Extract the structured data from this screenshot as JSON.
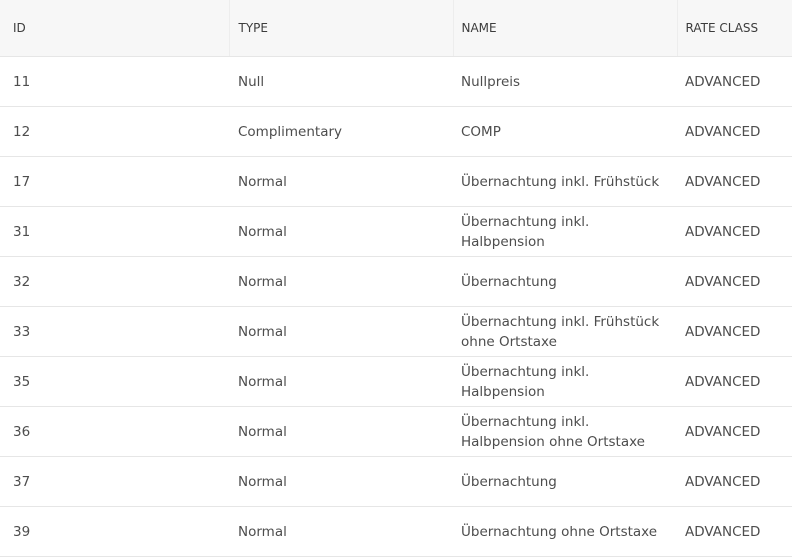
{
  "table": {
    "headers": {
      "id": "ID",
      "type": "TYPE",
      "name": "NAME",
      "rate_class": "RATE CLASS"
    },
    "rows": [
      {
        "id": "11",
        "type": "Null",
        "name": "Nullpreis",
        "rate_class": "ADVANCED"
      },
      {
        "id": "12",
        "type": "Complimentary",
        "name": "COMP",
        "rate_class": "ADVANCED"
      },
      {
        "id": "17",
        "type": "Normal",
        "name": "Übernachtung inkl. Frühstück",
        "rate_class": "ADVANCED"
      },
      {
        "id": "31",
        "type": "Normal",
        "name": "Übernachtung inkl. Halbpension",
        "rate_class": "ADVANCED"
      },
      {
        "id": "32",
        "type": "Normal",
        "name": "Übernachtung",
        "rate_class": "ADVANCED"
      },
      {
        "id": "33",
        "type": "Normal",
        "name": "Übernachtung inkl. Frühstück ohne Ortstaxe",
        "rate_class": "ADVANCED"
      },
      {
        "id": "35",
        "type": "Normal",
        "name": "Übernachtung inkl. Halbpension",
        "rate_class": "ADVANCED"
      },
      {
        "id": "36",
        "type": "Normal",
        "name": "Übernachtung inkl. Halbpension ohne Ortstaxe",
        "rate_class": "ADVANCED"
      },
      {
        "id": "37",
        "type": "Normal",
        "name": "Übernachtung",
        "rate_class": "ADVANCED"
      },
      {
        "id": "39",
        "type": "Normal",
        "name": "Übernachtung ohne Ortstaxe",
        "rate_class": "ADVANCED"
      }
    ]
  }
}
